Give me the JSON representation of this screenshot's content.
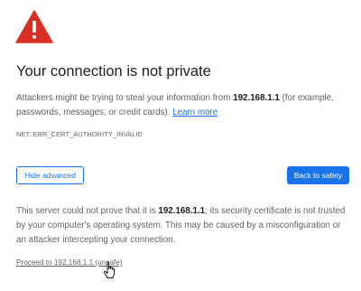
{
  "colors": {
    "warning_red": "#d93025",
    "accent_blue": "#1a73e8",
    "heading_text": "#202124",
    "body_text": "#5f6368"
  },
  "icons": {
    "warning": "warning-triangle-icon",
    "cursor": "hand-pointer-cursor"
  },
  "heading": "Your connection is not private",
  "intro": {
    "text_before": "Attackers might be trying to steal your information from ",
    "host": "192.168.1.1",
    "text_after": " (for example, passwords, messages, or credit cards). ",
    "learn_more": "Learn more"
  },
  "error_code": "NET::ERR_CERT_AUTHORITY_INVALID",
  "buttons": {
    "hide_advanced": "Hide advanced",
    "back_to_safety": "Back to safety"
  },
  "details": {
    "text_before": "This server could not prove that it is ",
    "host": "192.168.1.1",
    "text_after": "; its security certificate is not trusted by your computer's operating system. This may be caused by a misconfiguration or an attacker intercepting your connection."
  },
  "proceed_link": "Proceed to 192.168.1.1 (unsafe)"
}
